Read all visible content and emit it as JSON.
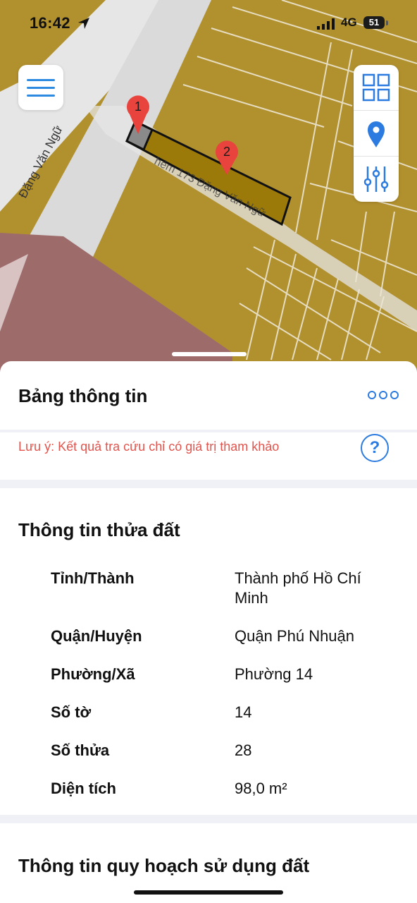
{
  "status_bar": {
    "time": "16:42",
    "network": "4G",
    "battery": "51"
  },
  "map": {
    "street_label": "Đặng Văn Ngữ",
    "alley_label": "hẻm 173 Đặng Văn Ngữ",
    "markers": [
      {
        "label": "1"
      },
      {
        "label": "2"
      }
    ],
    "colors": {
      "residential": "#b1902e",
      "road": "#dcdcdc",
      "parcel_fill": "#9b7a0a",
      "commercial": "#9e6b6b",
      "accent": "#2c7be0",
      "marker": "#e8433c"
    }
  },
  "controls": {
    "menu_icon": "hamburger-icon",
    "tools": [
      "grid-icon",
      "location-pin-icon",
      "sliders-icon"
    ]
  },
  "sheet": {
    "title": "Bảng thông tin",
    "more_icon": "more-icon",
    "note": "Lưu ý: Kết quả tra cứu chỉ có giá trị tham khảo",
    "help_label": "?",
    "parcel_section": {
      "title": "Thông tin thửa đất",
      "rows": [
        {
          "label": "Tỉnh/Thành",
          "value": "Thành phố Hồ Chí Minh"
        },
        {
          "label": "Quận/Huyện",
          "value": "Quận Phú Nhuận"
        },
        {
          "label": "Phường/Xã",
          "value": "Phường 14"
        },
        {
          "label": "Số tờ",
          "value": "14"
        },
        {
          "label": "Số thửa",
          "value": "28"
        },
        {
          "label": "Diện tích",
          "value": "98,0 m²"
        }
      ]
    },
    "planning_section": {
      "title": "Thông tin quy hoạch sử dụng đất"
    }
  }
}
